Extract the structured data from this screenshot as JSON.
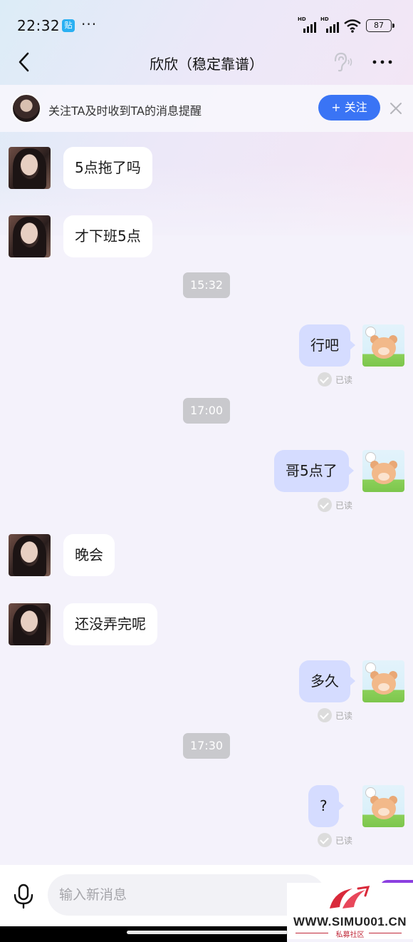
{
  "status_bar": {
    "time": "22:32",
    "paste_badge": "贴",
    "dots": "···",
    "signal1_label": "HD",
    "signal2_label": "HD",
    "battery": "87"
  },
  "nav": {
    "title": "欣欣（稳定靠谱）"
  },
  "follow_bar": {
    "text": "关注TA及时收到TA的消息提醒",
    "button": "+ 关注"
  },
  "messages": [
    {
      "side": "left",
      "text": "5点拖了吗"
    },
    {
      "side": "left",
      "text": "才下班5点"
    },
    {
      "side": "time",
      "text": "15:32"
    },
    {
      "side": "right",
      "text": "行吧",
      "status": "已读"
    },
    {
      "side": "time",
      "text": "17:00"
    },
    {
      "side": "right",
      "text": "哥5点了",
      "status": "已读"
    },
    {
      "side": "left",
      "text": "晚会"
    },
    {
      "side": "left",
      "text": "还没弄完呢"
    },
    {
      "side": "right",
      "text": "多久",
      "status": "已读"
    },
    {
      "side": "time",
      "text": "17:30"
    },
    {
      "side": "right",
      "text": "?",
      "status": "已读"
    }
  ],
  "input": {
    "placeholder": "输入新消息"
  },
  "watermark": {
    "url": "WWW.SIMU001.CN",
    "sub": "私募社区"
  },
  "colors": {
    "accent": "#3a74f5",
    "bubble_right": "#d5dcff",
    "bubble_left": "#ffffff",
    "timestamp_bg": "#c9c9cd"
  }
}
